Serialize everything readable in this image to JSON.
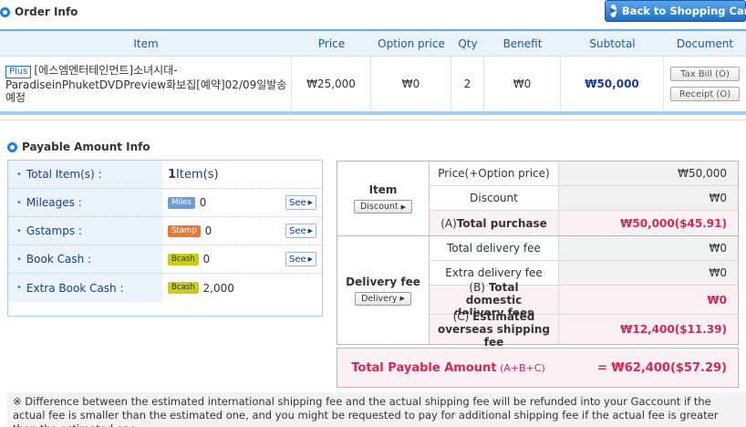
{
  "order_section": {
    "title": "Order Info",
    "back_button": "Back to Shopping Cart"
  },
  "order_table": {
    "headers": [
      "Item",
      "Price",
      "Option price",
      "Qty",
      "Benefit",
      "Subtotal",
      "Document"
    ],
    "row": {
      "badge": "Plus",
      "item_name": "[에스엠엔터테인먼트]소녀시대-ParadiseinPhuketDVDPreview화보집[예약]02/09일발송예정",
      "price": "₩25,000",
      "option_price": "₩0",
      "qty": "2",
      "benefit": "₩0",
      "subtotal": "₩50,000",
      "tax_bill": "Tax Bill (O)",
      "receipt": "Receipt (O)"
    }
  },
  "payable_section": {
    "title": "Payable Amount Info"
  },
  "info_box": {
    "rows": [
      {
        "label": "Total Item(s) :",
        "value_bold": "1",
        "value": " Item(s)"
      },
      {
        "label": "Mileages :",
        "badge": "Miles",
        "value": "0",
        "see": "See"
      },
      {
        "label": "Gstamps :",
        "badge": "Stamp",
        "value": "0",
        "see": "See"
      },
      {
        "label": "Book Cash :",
        "badge": "Bcash",
        "value": "0",
        "see": "See"
      },
      {
        "label": "Extra Book Cash :",
        "badge": "Bcash",
        "value": "2,000"
      }
    ]
  },
  "summary": {
    "item_group": {
      "label": "Item",
      "button": "Discount",
      "rows": [
        {
          "label": "Price(+Option price)",
          "value": "₩50,000"
        },
        {
          "label": "Discount",
          "value": "₩0"
        },
        {
          "label_prefix": "(A) ",
          "label": "Total purchase",
          "value": "₩50,000($45.91)"
        }
      ]
    },
    "delivery_group": {
      "label": "Delivery fee",
      "button": "Delivery",
      "rows": [
        {
          "label": "Total delivery fee",
          "value": "₩0"
        },
        {
          "label": "Extra delivery fee",
          "value": "₩0"
        },
        {
          "label_prefix": "(B) ",
          "label": "Total domestic delivery fees",
          "value": "₩0"
        },
        {
          "label_prefix": "(C) ",
          "label": "Estimated overseas shipping fee",
          "value": "₩12,400($11.39)"
        }
      ]
    },
    "total": {
      "label": "Total Payable Amount",
      "label_sub": " (A+B+C)",
      "value": "=  ₩62,400($57.29)"
    }
  },
  "note": "※ Difference between the estimated international shipping fee and the actual shipping fee will be refunded into your Gaccount if the actual fee is smaller than the estimated one, and you might be requested to pay for additional shipping fee if the actual fee is greater than the estimated one."
}
